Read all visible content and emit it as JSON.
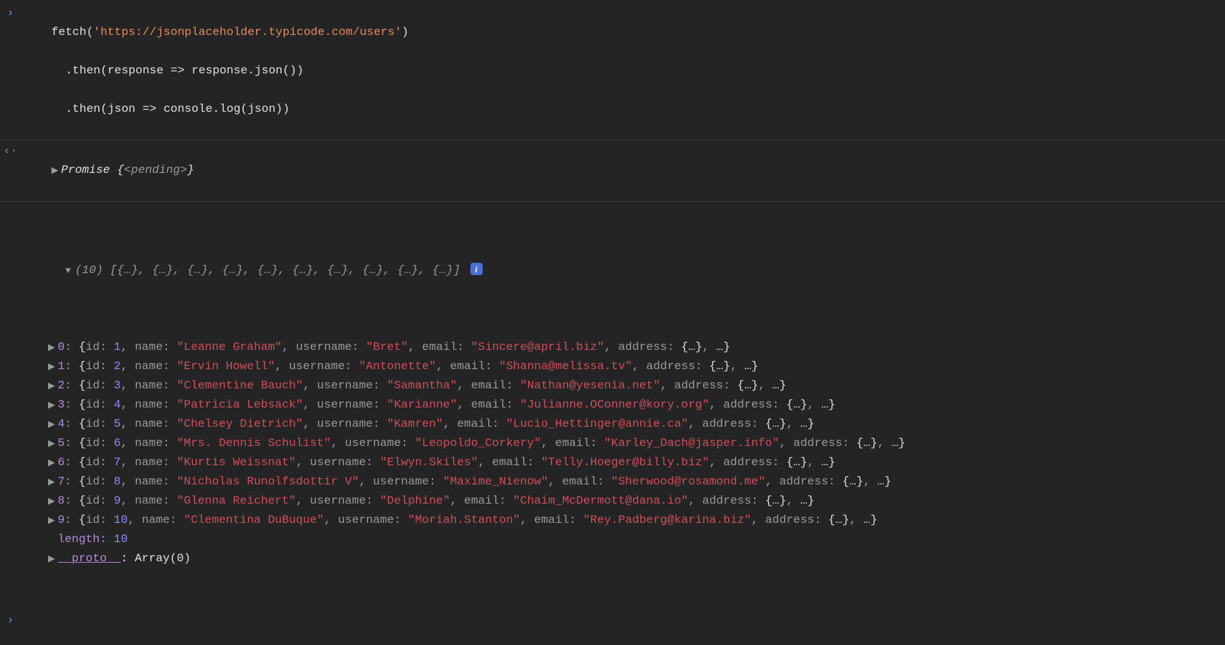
{
  "input": {
    "line1_pre": "fetch(",
    "line1_url": "'https://jsonplaceholder.typicode.com/users'",
    "line1_post": ")",
    "line2_pre": "  .then(",
    "line2_param": "response",
    "line2_arrow": " => ",
    "line2_body": "response.json()",
    "line2_post": ")",
    "line3_pre": "  .then(",
    "line3_param": "json",
    "line3_arrow": " => ",
    "line3_body": "console.log(json)",
    "line3_post": ")"
  },
  "promise": {
    "label": "Promise ",
    "open": "{",
    "state": "<pending>",
    "close": "}"
  },
  "array_summary": {
    "count": "(10)",
    "body": " [{…}, {…}, {…}, {…}, {…}, {…}, {…}, {…}, {…}, {…}]"
  },
  "items": [
    {
      "idx": "0",
      "id": "1",
      "name": "\"Leanne Graham\"",
      "username": "\"Bret\"",
      "email": "\"Sincere@april.biz\""
    },
    {
      "idx": "1",
      "id": "2",
      "name": "\"Ervin Howell\"",
      "username": "\"Antonette\"",
      "email": "\"Shanna@melissa.tv\""
    },
    {
      "idx": "2",
      "id": "3",
      "name": "\"Clementine Bauch\"",
      "username": "\"Samantha\"",
      "email": "\"Nathan@yesenia.net\""
    },
    {
      "idx": "3",
      "id": "4",
      "name": "\"Patricia Lebsack\"",
      "username": "\"Karianne\"",
      "email": "\"Julianne.OConner@kory.org\""
    },
    {
      "idx": "4",
      "id": "5",
      "name": "\"Chelsey Dietrich\"",
      "username": "\"Kamren\"",
      "email": "\"Lucio_Hettinger@annie.ca\""
    },
    {
      "idx": "5",
      "id": "6",
      "name": "\"Mrs. Dennis Schulist\"",
      "username": "\"Leopoldo_Corkery\"",
      "email": "\"Karley_Dach@jasper.info\""
    },
    {
      "idx": "6",
      "id": "7",
      "name": "\"Kurtis Weissnat\"",
      "username": "\"Elwyn.Skiles\"",
      "email": "\"Telly.Hoeger@billy.biz\""
    },
    {
      "idx": "7",
      "id": "8",
      "name": "\"Nicholas Runolfsdottir V\"",
      "username": "\"Maxime_Nienow\"",
      "email": "\"Sherwood@rosamond.me\""
    },
    {
      "idx": "8",
      "id": "9",
      "name": "\"Glenna Reichert\"",
      "username": "\"Delphine\"",
      "email": "\"Chaim_McDermott@dana.io\""
    },
    {
      "idx": "9",
      "id": "10",
      "name": "\"Clementina DuBuque\"",
      "username": "\"Moriah.Stanton\"",
      "email": "\"Rey.Padberg@karina.biz\""
    }
  ],
  "labels": {
    "id": "id: ",
    "name": "name: ",
    "username": "username: ",
    "email": "email: ",
    "address": "address: ",
    "address_val": "{…}",
    "rest": "…",
    "length_key": "length: ",
    "length_val": "10",
    "proto_key": "__proto__",
    "proto_val": ": Array(0)",
    "colon_sp": ": ",
    "comma": ", ",
    "brace_open": "{",
    "brace_close": "}"
  },
  "glyphs": {
    "input_prompt": "›",
    "result_prompt": "‹·",
    "tri_right": "▶",
    "tri_down": "▼",
    "info": "i",
    "new_prompt": "›"
  }
}
